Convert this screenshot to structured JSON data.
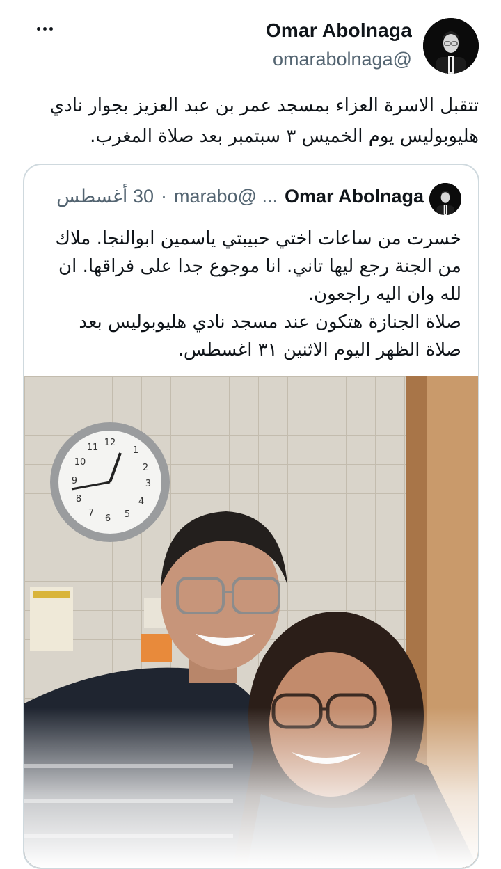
{
  "author": {
    "name": "Omar Abolnaga",
    "handle": "omarabolnaga@"
  },
  "tweet_text": "تتقبل الاسرة العزاء بمسجد عمر بن عبد العزيز بجوار نادي هليوبوليس يوم الخميس ٣ سبتمبر بعد صلاة المغرب.",
  "quoted": {
    "name": "Omar Abolnaga",
    "handle": "marabo@ ...",
    "separator": "·",
    "date": "30 أغسطس",
    "text_lines": [
      "خسرت من ساعات اختي حبيبتي ياسمين ابوالنجا. ملاك",
      "من الجنة رجع ليها تاني. انا موجوع جدا على فراقها. ان",
      "لله وان اليه راجعون.",
      "صلاة الجنازة هتكون عند مسجد نادي هليوبوليس بعد",
      "صلاة الظهر اليوم الاثنين ٣١ اغسطس."
    ]
  },
  "icons": {
    "more": "more-horizontal-icon"
  },
  "colors": {
    "text": "#0f1419",
    "secondary": "#536471",
    "border": "#cfd9de"
  }
}
